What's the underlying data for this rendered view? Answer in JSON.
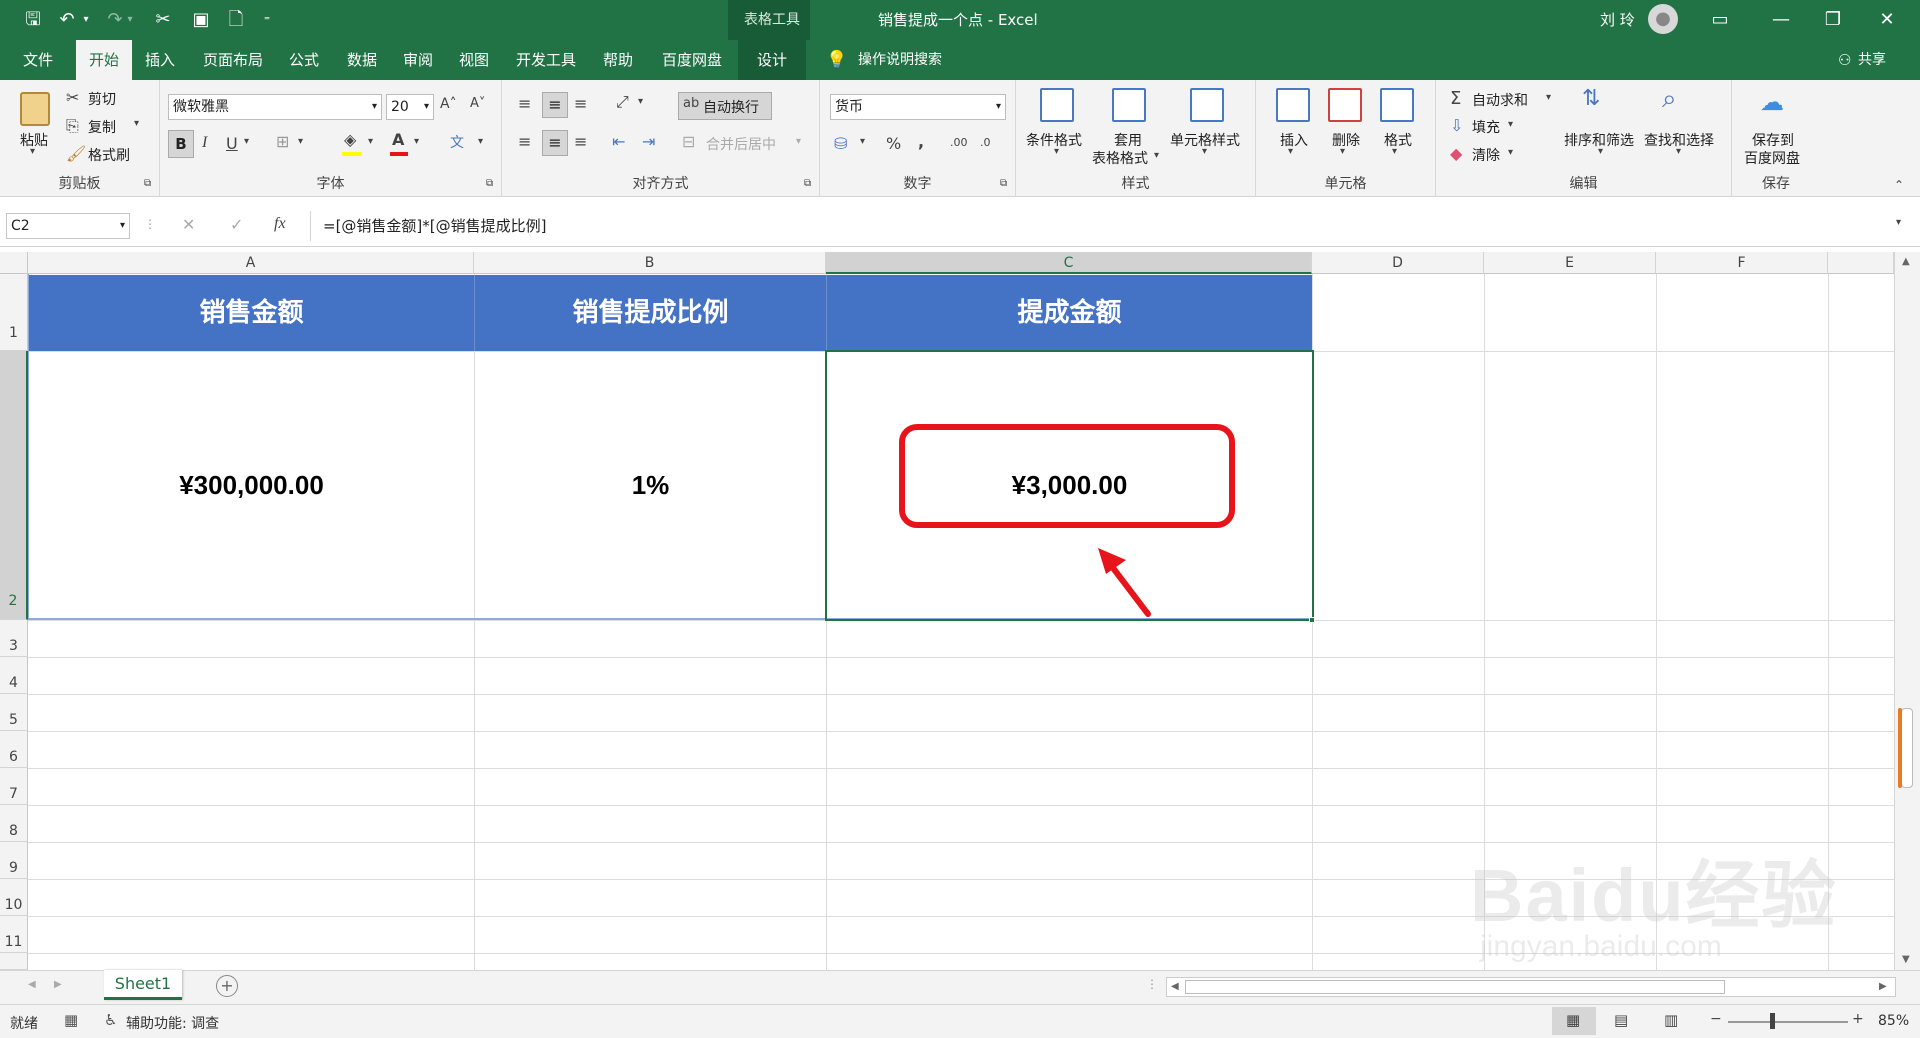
{
  "title_bar": {
    "context_label": "表格工具",
    "document_title": "销售提成一个点 - Excel",
    "user_name": "刘 玲"
  },
  "tabs": [
    {
      "label": "文件"
    },
    {
      "label": "开始"
    },
    {
      "label": "插入"
    },
    {
      "label": "页面布局"
    },
    {
      "label": "公式"
    },
    {
      "label": "数据"
    },
    {
      "label": "审阅"
    },
    {
      "label": "视图"
    },
    {
      "label": "开发工具"
    },
    {
      "label": "帮助"
    },
    {
      "label": "百度网盘"
    },
    {
      "label": "设计"
    }
  ],
  "tell_me": "操作说明搜索",
  "share": "共享",
  "ribbon": {
    "clipboard": {
      "paste": "粘贴",
      "cut": "剪切",
      "copy": "复制",
      "format_painter": "格式刷",
      "label": "剪贴板"
    },
    "font": {
      "name": "微软雅黑",
      "size": "20",
      "label": "字体"
    },
    "alignment": {
      "wrap_text": "自动换行",
      "merge_center": "合并后居中",
      "label": "对齐方式"
    },
    "number": {
      "format": "货币",
      "label": "数字"
    },
    "styles": {
      "conditional": "条件格式",
      "table_format_1": "套用",
      "table_format_2": "表格格式",
      "cell_styles": "单元格样式",
      "label": "样式"
    },
    "cells": {
      "insert": "插入",
      "delete": "删除",
      "format": "格式",
      "label": "单元格"
    },
    "editing": {
      "autosum": "自动求和",
      "fill": "填充",
      "clear": "清除",
      "sort_filter": "排序和筛选",
      "find_select": "查找和选择",
      "label": "编辑"
    },
    "save": {
      "save_to_1": "保存到",
      "save_to_2": "百度网盘",
      "label": "保存"
    }
  },
  "formula_bar": {
    "name_box": "C2",
    "fx": "fx",
    "formula": "=[@销售金额]*[@销售提成比例]"
  },
  "columns": [
    "A",
    "B",
    "C",
    "D",
    "E",
    "F"
  ],
  "rows": [
    "1",
    "2",
    "3",
    "4",
    "5",
    "6",
    "7",
    "8",
    "9",
    "10",
    "11"
  ],
  "table": {
    "headers": [
      "销售金额",
      "销售提成比例",
      "提成金额"
    ],
    "values": [
      "¥300,000.00",
      "1%",
      "¥3,000.00"
    ]
  },
  "sheet_tab": "Sheet1",
  "status": {
    "ready": "就绪",
    "accessibility": "辅助功能: 调查",
    "zoom": "85%"
  },
  "watermark": "Baidu经验 jingyan.baidu.com",
  "colors": {
    "excel_green": "#217346",
    "header_blue": "#4472c4",
    "highlight_red": "#e8141b"
  }
}
